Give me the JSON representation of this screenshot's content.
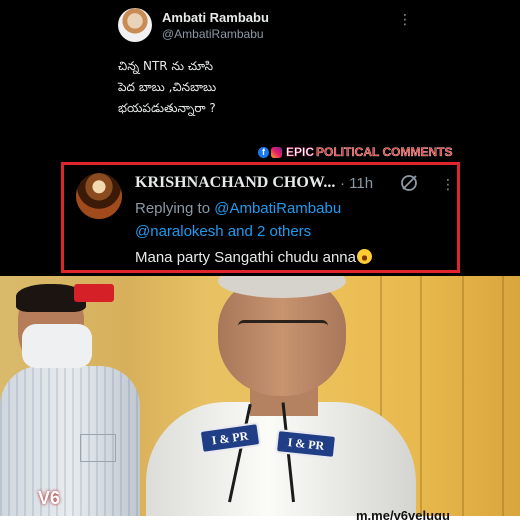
{
  "top_tweet": {
    "name": "Ambati Rambabu",
    "handle": "@AmbatiRambabu",
    "more_icon": "more-vertical-icon",
    "lines": [
      "చిన్న NTR ను చూసి",
      "పెద బాబు ,చినబాబు",
      "భయపడుతున్నారా ?"
    ]
  },
  "watermark": {
    "part1": "EPIC",
    "part2": "POLITICAL COMMENTS",
    "icons": [
      "facebook-icon",
      "instagram-icon"
    ],
    "colors": {
      "part1": "#ffffff",
      "part2": "#e53935"
    }
  },
  "reply": {
    "name": "KRISHNACHAND CHOW...",
    "time": "· 11h",
    "replying_prefix": "Replying to",
    "replying_mention": "@AmbatiRambabu",
    "others": "@naralokesh and 2 others",
    "text": "Mana party Sangathi chudu anna",
    "emoji": "laughing-emoji",
    "border_color": "#e0242d",
    "link_color": "#1d9bf0"
  },
  "video": {
    "badge_left": "I & PR",
    "badge_right": "I & PR",
    "channel_logo": "V6",
    "url": "m.me/v6velugu"
  }
}
